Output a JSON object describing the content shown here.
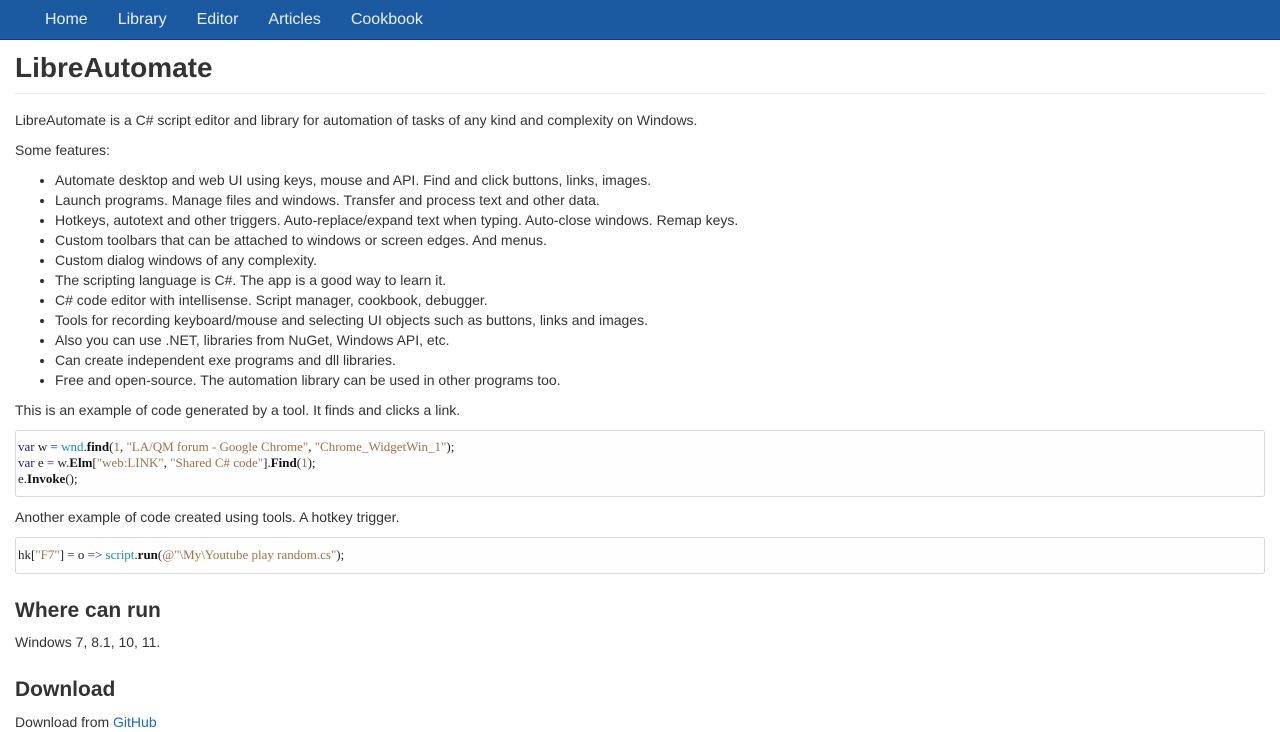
{
  "nav": {
    "items": [
      {
        "label": "Home"
      },
      {
        "label": "Library"
      },
      {
        "label": "Editor"
      },
      {
        "label": "Articles"
      },
      {
        "label": "Cookbook"
      }
    ]
  },
  "page": {
    "title": "LibreAutomate",
    "intro": "LibreAutomate is a C# script editor and library for automation of tasks of any kind and complexity on Windows.",
    "features_heading": "Some features:",
    "features": [
      "Automate desktop and web UI using keys, mouse and API. Find and click buttons, links, images.",
      "Launch programs. Manage files and windows. Transfer and process text and other data.",
      "Hotkeys, autotext and other triggers. Auto-replace/expand text when typing. Auto-close windows. Remap keys.",
      "Custom toolbars that can be attached to windows or screen edges. And menus.",
      "Custom dialog windows of any complexity.",
      "The scripting language is C#. The app is a good way to learn it.",
      "C# code editor with intellisense. Script manager, cookbook, debugger.",
      "Tools for recording keyboard/mouse and selecting UI objects such as buttons, links and images.",
      "Also you can use .NET, libraries from NuGet, Windows API, etc.",
      "Can create independent exe programs and dll libraries.",
      "Free and open-source. The automation library can be used in other programs too."
    ],
    "example1_text": "This is an example of code generated by a tool. It finds and clicks a link.",
    "code1": {
      "l1": {
        "kw": "var",
        "v": " w ",
        "eq": "=",
        "ty": " wnd",
        "dot": ".",
        "fn": "find",
        "p1": "(",
        "n": "1",
        "c": ", ",
        "s1": "\"LA/QM forum - Google Chrome\"",
        "c2": ", ",
        "s2": "\"Chrome_WidgetWin_1\"",
        "end": ");"
      },
      "l2": {
        "kw": "var",
        "v": " e ",
        "eq": "=",
        "w": " w.",
        "fn": "Elm",
        "b1": "[",
        "s1": "\"web:LINK\"",
        "c": ", ",
        "s2": "\"Shared C# code\"",
        "b2": "].",
        "fn2": "Find",
        "p1": "(",
        "n": "1",
        "end": ");"
      },
      "l3": {
        "v": "e.",
        "fn": "Invoke",
        "end": "();"
      }
    },
    "example2_text": "Another example of code created using tools. A hotkey trigger.",
    "code2": {
      "a": "hk[",
      "s1": "\"F7\"",
      "b": "] = o ",
      "arrow": "=>",
      "ty": " script",
      "dot": ".",
      "fn": "run",
      "p": "(",
      "s2": "@\"\\My\\Youtube play random.cs\"",
      "end": ");"
    },
    "where_heading": "Where can run",
    "where_text": "Windows 7, 8.1, 10, 11.",
    "download_heading": "Download",
    "download_prefix": "Download from ",
    "download_link": "GitHub"
  }
}
